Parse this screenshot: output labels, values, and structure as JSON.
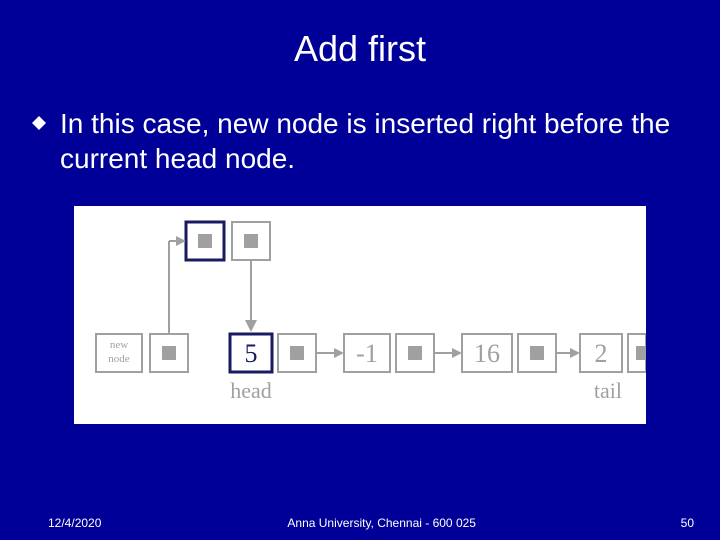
{
  "title": "Add first",
  "body": "In this case, new node is inserted right before the current head node.",
  "diagram": {
    "new_node_label": "new\nnode",
    "values": [
      "5",
      "-1",
      "16",
      "2"
    ],
    "head_label": "head",
    "tail_label": "tail"
  },
  "footer": {
    "date": "12/4/2020",
    "org": "Anna University, Chennai - 600 025",
    "page": "50"
  },
  "colors": {
    "grey": "#a0a0a0",
    "darknavy": "#1a1a60"
  }
}
